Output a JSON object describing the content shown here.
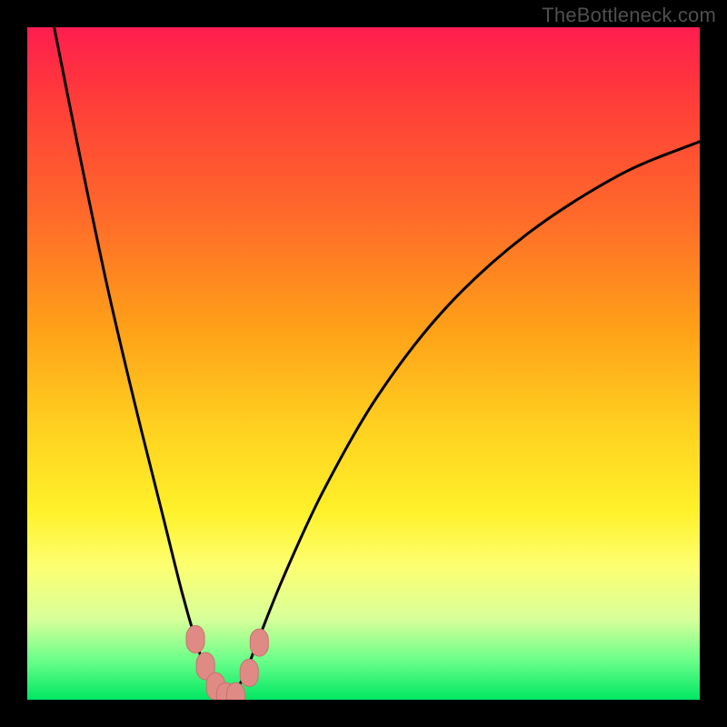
{
  "watermark": {
    "text": "TheBottleneck.com"
  },
  "colors": {
    "curve": "#000000",
    "marker_fill": "#e08a86",
    "marker_stroke": "#c9726d",
    "frame": "#000000"
  },
  "chart_data": {
    "type": "line",
    "title": "",
    "xlabel": "",
    "ylabel": "",
    "xlim": [
      0,
      100
    ],
    "ylim": [
      0,
      100
    ],
    "note": "V-shaped bottleneck curve; y≈0 is ideal (green), y≈100 is worst (red). Minimum near x≈29.",
    "series": [
      {
        "name": "bottleneck-curve",
        "x": [
          4,
          8,
          12,
          16,
          20,
          23,
          25,
          27,
          28.5,
          30,
          32,
          34,
          38,
          44,
          52,
          62,
          74,
          88,
          100
        ],
        "values": [
          100,
          80,
          61,
          44,
          28,
          16,
          9,
          3,
          0.5,
          0.5,
          3,
          8,
          18,
          31,
          45,
          58,
          69,
          78,
          83
        ]
      }
    ],
    "markers": {
      "name": "highlighted-region",
      "x": [
        25.0,
        26.5,
        28.0,
        29.5,
        31.0,
        33.0,
        34.5
      ],
      "values": [
        9.0,
        5.0,
        2.0,
        0.5,
        0.5,
        4.0,
        8.5
      ]
    }
  }
}
